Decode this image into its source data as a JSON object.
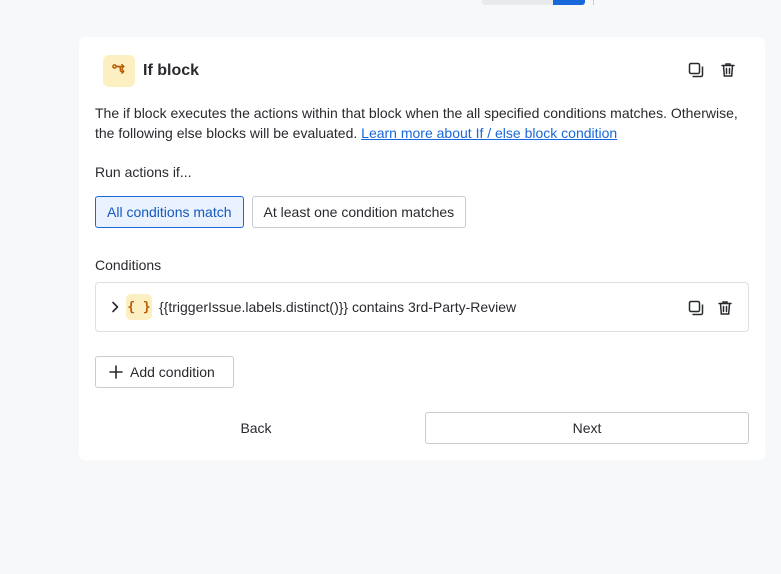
{
  "block": {
    "title": "If block",
    "description": "The if block executes the actions within that block when the all specified conditions matches. Otherwise, the following else blocks will be evaluated.",
    "learn_more_link": "Learn more about If / else block condition"
  },
  "run_actions": {
    "label": "Run actions if...",
    "options": [
      {
        "label": "All conditions match",
        "selected": true
      },
      {
        "label": "At least one condition matches",
        "selected": false
      }
    ]
  },
  "conditions": {
    "label": "Conditions",
    "items": [
      {
        "icon_text": "{ }",
        "text": "{{triggerIssue.labels.distinct()}} contains 3rd-Party-Review"
      }
    ],
    "add_label": "Add condition"
  },
  "footer": {
    "back_label": "Back",
    "next_label": "Next"
  },
  "icons": {
    "block": "branch-icon",
    "duplicate": "duplicate-icon",
    "delete": "trash-icon",
    "expand": "chevron-right-icon",
    "expression": "curly-braces-icon",
    "add": "plus-icon"
  },
  "colors": {
    "accent": "#1868db",
    "icon_bg": "#fcefc2",
    "icon_fg": "#b65c02"
  }
}
